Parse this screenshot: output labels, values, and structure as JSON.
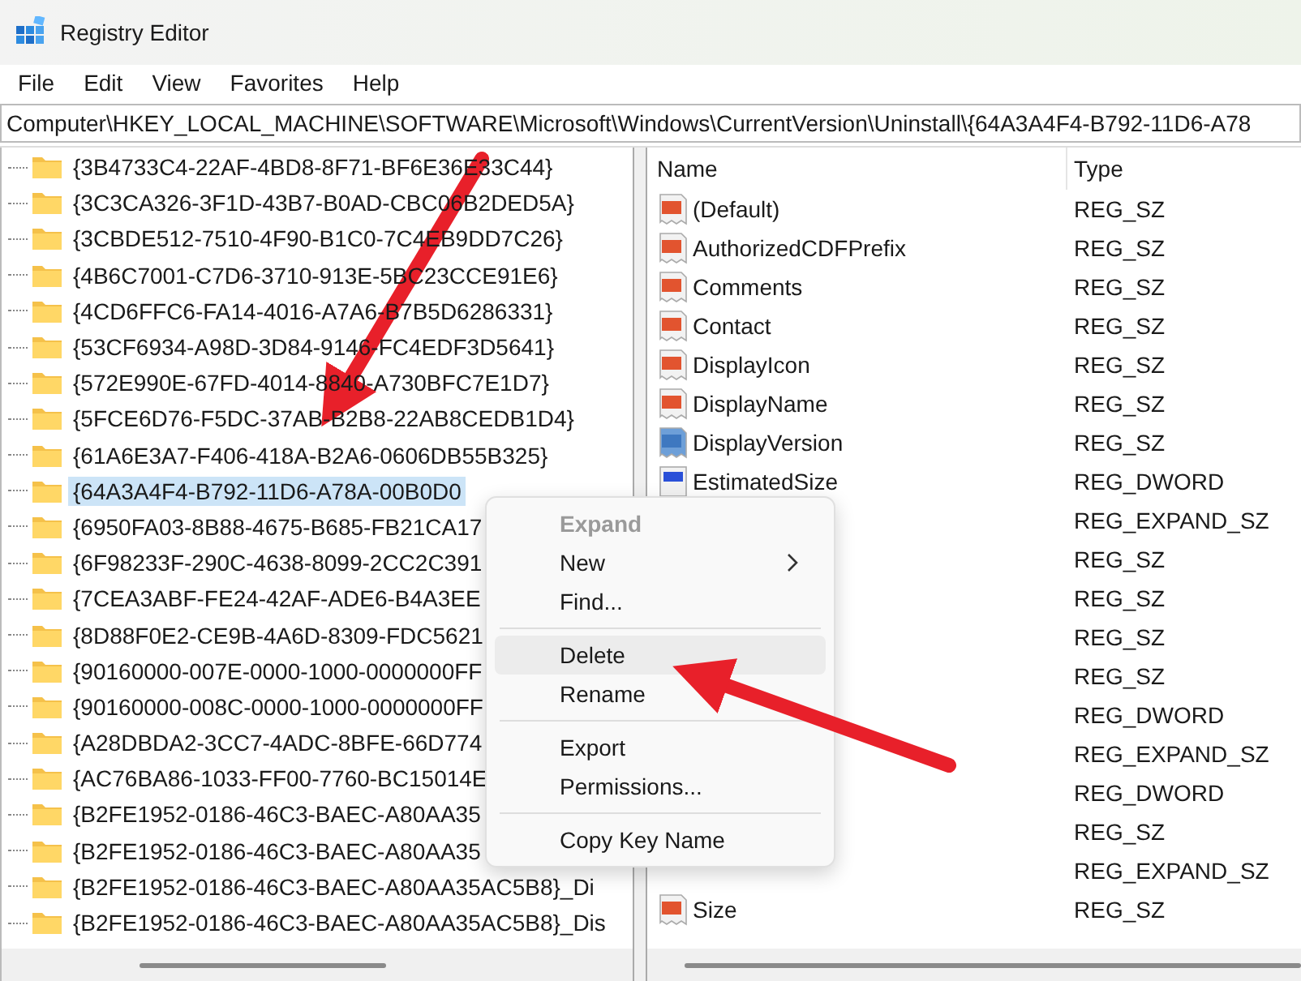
{
  "window": {
    "title": "Registry Editor"
  },
  "menu_bar": [
    "File",
    "Edit",
    "View",
    "Favorites",
    "Help"
  ],
  "address": "Computer\\HKEY_LOCAL_MACHINE\\SOFTWARE\\Microsoft\\Windows\\CurrentVersion\\Uninstall\\{64A3A4F4-B792-11D6-A78",
  "tree": [
    {
      "label": "{3B4733C4-22AF-4BD8-8F71-BF6E36E33C44}",
      "selected": false
    },
    {
      "label": "{3C3CA326-3F1D-43B7-B0AD-CBC06B2DED5A}",
      "selected": false
    },
    {
      "label": "{3CBDE512-7510-4F90-B1C0-7C4EB9DD7C26}",
      "selected": false
    },
    {
      "label": "{4B6C7001-C7D6-3710-913E-5BC23CCE91E6}",
      "selected": false
    },
    {
      "label": "{4CD6FFC6-FA14-4016-A7A6-B7B5D6286331}",
      "selected": false
    },
    {
      "label": "{53CF6934-A98D-3D84-9146-FC4EDF3D5641}",
      "selected": false
    },
    {
      "label": "{572E990E-67FD-4014-8840-A730BFC7E1D7}",
      "selected": false
    },
    {
      "label": "{5FCE6D76-F5DC-37AB-B2B8-22AB8CEDB1D4}",
      "selected": false
    },
    {
      "label": "{61A6E3A7-F406-418A-B2A6-0606DB55B325}",
      "selected": false
    },
    {
      "label": "{64A3A4F4-B792-11D6-A78A-00B0D0",
      "selected": true
    },
    {
      "label": "{6950FA03-8B88-4675-B685-FB21CA17",
      "selected": false
    },
    {
      "label": "{6F98233F-290C-4638-8099-2CC2C391",
      "selected": false
    },
    {
      "label": "{7CEA3ABF-FE24-42AF-ADE6-B4A3EE",
      "selected": false
    },
    {
      "label": "{8D88F0E2-CE9B-4A6D-8309-FDC5621",
      "selected": false
    },
    {
      "label": "{90160000-007E-0000-1000-0000000FF",
      "selected": false
    },
    {
      "label": "{90160000-008C-0000-1000-0000000FF",
      "selected": false
    },
    {
      "label": "{A28DBDA2-3CC7-4ADC-8BFE-66D774",
      "selected": false
    },
    {
      "label": "{AC76BA86-1033-FF00-7760-BC15014E",
      "selected": false
    },
    {
      "label": "{B2FE1952-0186-46C3-BAEC-A80AA35",
      "selected": false
    },
    {
      "label": "{B2FE1952-0186-46C3-BAEC-A80AA35",
      "selected": false
    },
    {
      "label": "{B2FE1952-0186-46C3-BAEC-A80AA35AC5B8}_Di",
      "selected": false
    },
    {
      "label": "{B2FE1952-0186-46C3-BAEC-A80AA35AC5B8}_Dis",
      "selected": false
    }
  ],
  "values": {
    "columns": [
      "Name",
      "Type"
    ],
    "rows": [
      {
        "kind": "string",
        "name": "(Default)",
        "type": "REG_SZ"
      },
      {
        "kind": "string",
        "name": "AuthorizedCDFPrefix",
        "type": "REG_SZ"
      },
      {
        "kind": "string",
        "name": "Comments",
        "type": "REG_SZ"
      },
      {
        "kind": "string",
        "name": "Contact",
        "type": "REG_SZ"
      },
      {
        "kind": "string",
        "name": "DisplayIcon",
        "type": "REG_SZ"
      },
      {
        "kind": "string",
        "name": "DisplayName",
        "type": "REG_SZ"
      },
      {
        "kind": "string",
        "name": "DisplayVersion",
        "type": "REG_SZ",
        "selected": true
      },
      {
        "kind": "dword",
        "name": "EstimatedSize",
        "type": "REG_DWORD"
      },
      {
        "kind": "hidden",
        "type": "REG_EXPAND_SZ"
      },
      {
        "kind": "hidden",
        "type": "REG_SZ"
      },
      {
        "kind": "hidden",
        "type": "REG_SZ"
      },
      {
        "kind": "hidden",
        "type": "REG_SZ"
      },
      {
        "kind": "hidden",
        "type": "REG_SZ"
      },
      {
        "kind": "hidden",
        "type": "REG_DWORD"
      },
      {
        "kind": "hidden",
        "type": "REG_EXPAND_SZ"
      },
      {
        "kind": "hidden",
        "type": "REG_DWORD"
      },
      {
        "kind": "hidden",
        "type": "REG_SZ"
      },
      {
        "kind": "hidden",
        "type": "REG_EXPAND_SZ"
      },
      {
        "kind": "string",
        "name": "Size",
        "type": "REG_SZ"
      }
    ]
  },
  "context_menu": [
    {
      "kind": "item",
      "label": "Expand",
      "disabled": true,
      "hover": false
    },
    {
      "kind": "submenu",
      "label": "New",
      "disabled": false,
      "hover": false
    },
    {
      "kind": "item",
      "label": "Find...",
      "disabled": false,
      "hover": false
    },
    {
      "kind": "separator"
    },
    {
      "kind": "item",
      "label": "Delete",
      "disabled": false,
      "hover": true
    },
    {
      "kind": "item",
      "label": "Rename",
      "disabled": false,
      "hover": false
    },
    {
      "kind": "separator"
    },
    {
      "kind": "item",
      "label": "Export",
      "disabled": false,
      "hover": false
    },
    {
      "kind": "item",
      "label": "Permissions...",
      "disabled": false,
      "hover": false
    },
    {
      "kind": "separator"
    },
    {
      "kind": "item",
      "label": "Copy Key Name",
      "disabled": false,
      "hover": false
    }
  ]
}
